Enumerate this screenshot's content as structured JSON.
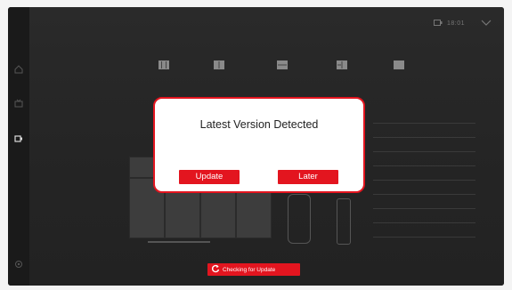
{
  "sidebar": {
    "items": [
      {
        "icon": "home-icon"
      },
      {
        "icon": "tv-icon"
      },
      {
        "icon": "input-source-icon",
        "active": true
      },
      {
        "icon": "settings-icon"
      }
    ]
  },
  "status": {
    "time": "18:01",
    "icons": [
      "screen-cast-icon",
      "wifi-icon"
    ]
  },
  "mode_icons": [
    "mode-icon-1",
    "mode-icon-2",
    "mode-icon-3",
    "mode-icon-4",
    "mode-icon-5"
  ],
  "dialog": {
    "title": "Latest Version Detected",
    "update_label": "Update",
    "later_label": "Later"
  },
  "toast": {
    "icon": "refresh-icon",
    "text": "Checking for Update"
  },
  "colors": {
    "accent": "#e3151f",
    "background": "#232323",
    "dialog_bg": "#ffffff"
  }
}
